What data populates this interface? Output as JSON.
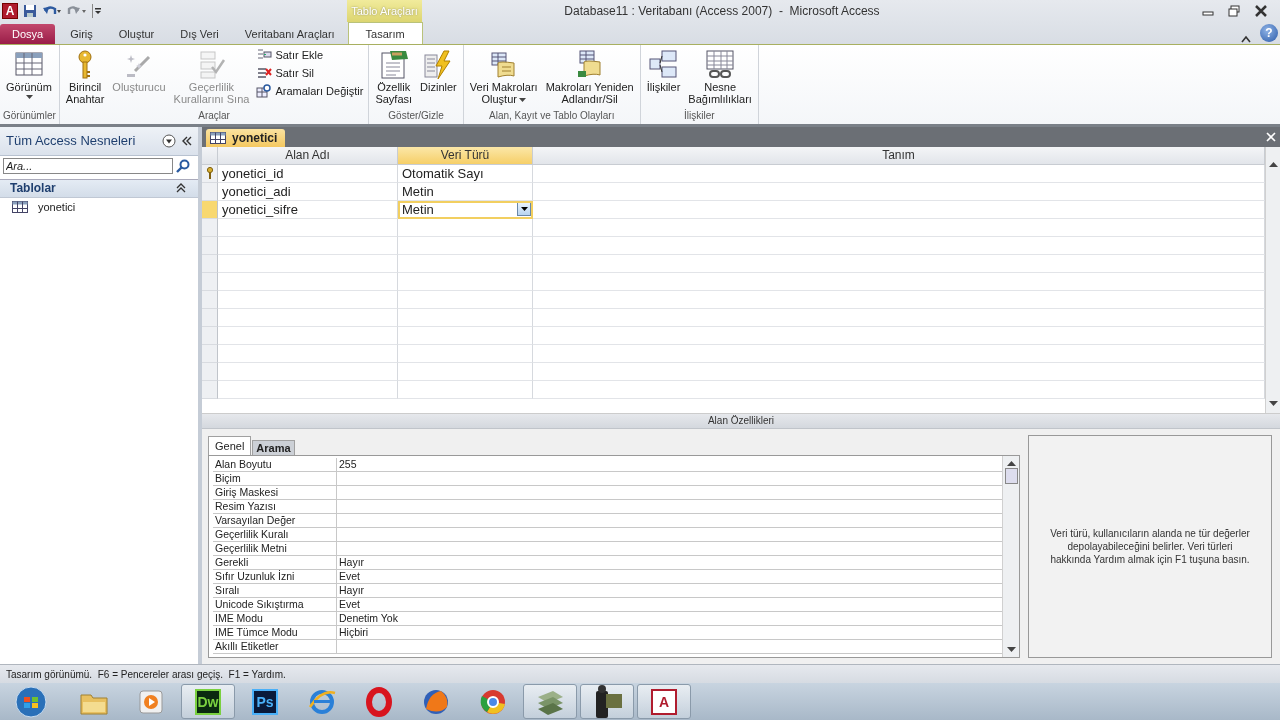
{
  "window": {
    "app_glyph": "A",
    "context_group": "Tablo Araçları",
    "title": "Database11 : Veritabanı (Access 2007)  -  Microsoft Access",
    "help_glyph": "?"
  },
  "ribbon_tabs": [
    {
      "label": "Dosya",
      "kind": "file",
      "selected": false
    },
    {
      "label": "Giriş",
      "kind": "tab",
      "selected": false
    },
    {
      "label": "Oluştur",
      "kind": "tab",
      "selected": false
    },
    {
      "label": "Dış Veri",
      "kind": "tab",
      "selected": false
    },
    {
      "label": "Veritabanı Araçları",
      "kind": "tab",
      "selected": false
    },
    {
      "label": "Tasarım",
      "kind": "context",
      "selected": true
    }
  ],
  "ribbon_groups": [
    {
      "label": "Görünümler",
      "buttons": [
        {
          "label": "Görünüm",
          "kind": "large",
          "disabled": false,
          "dropdown": true
        }
      ]
    },
    {
      "label": "Araçlar",
      "buttons": [
        {
          "label": "Birincil\nAnahtar",
          "kind": "large",
          "disabled": false,
          "dropdown": false
        },
        {
          "label": "Oluşturucu",
          "kind": "large",
          "disabled": true,
          "dropdown": false
        },
        {
          "label": "Geçerlilik\nKurallarını Sına",
          "kind": "large",
          "disabled": true,
          "dropdown": false
        },
        {
          "label": "Satır Ekle",
          "kind": "small",
          "disabled": false,
          "dropdown": false
        },
        {
          "label": "Satır Sil",
          "kind": "small",
          "disabled": false,
          "dropdown": false
        },
        {
          "label": "Aramaları Değiştir",
          "kind": "small",
          "disabled": false,
          "dropdown": false
        }
      ]
    },
    {
      "label": "Göster/Gizle",
      "buttons": [
        {
          "label": "Özellik\nSayfası",
          "kind": "large",
          "disabled": false,
          "dropdown": false
        },
        {
          "label": "Dizinler",
          "kind": "large",
          "disabled": false,
          "dropdown": false
        }
      ]
    },
    {
      "label": "Alan, Kayıt ve Tablo Olayları",
      "buttons": [
        {
          "label": "Veri Makroları\nOluştur",
          "kind": "large",
          "disabled": false,
          "dropdown": true
        },
        {
          "label": "Makroları Yeniden\nAdlandır/Sil",
          "kind": "large",
          "disabled": false,
          "dropdown": false
        }
      ]
    },
    {
      "label": "İlişkiler",
      "buttons": [
        {
          "label": "İlişkiler",
          "kind": "large",
          "disabled": false,
          "dropdown": false
        },
        {
          "label": "Nesne\nBağımlılıkları",
          "kind": "large",
          "disabled": false,
          "dropdown": false
        }
      ]
    }
  ],
  "navigation_pane": {
    "title": "Tüm Access Nesneleri",
    "search": {
      "placeholder": "Ara..."
    },
    "groups": [
      {
        "label": "Tablolar",
        "expanded": true,
        "items": [
          {
            "label": "yonetici"
          }
        ]
      }
    ]
  },
  "document_tabs": [
    {
      "label": "yonetici",
      "selected": true
    }
  ],
  "design_grid": {
    "columns": [
      {
        "label": "Alan Adı",
        "selected": false
      },
      {
        "label": "Veri Türü",
        "selected": true
      },
      {
        "label": "Tanım",
        "selected": false
      }
    ],
    "rows": [
      {
        "field_name": "yonetici_id",
        "data_type": "Otomatik Sayı",
        "primary_key": true,
        "selected": false
      },
      {
        "field_name": "yonetici_adi",
        "data_type": "Metin",
        "primary_key": false,
        "selected": false
      },
      {
        "field_name": "yonetici_sifre",
        "data_type": "Metin",
        "primary_key": false,
        "selected": true
      }
    ]
  },
  "field_properties": {
    "title": "Alan Özellikleri",
    "tabs": [
      {
        "label": "Genel",
        "selected": true
      },
      {
        "label": "Arama",
        "selected": false
      }
    ],
    "rows": [
      {
        "name": "Alan Boyutu",
        "value": "255"
      },
      {
        "name": "Biçim"
      },
      {
        "name": "Giriş Maskesi"
      },
      {
        "name": "Resim Yazısı"
      },
      {
        "name": "Varsayılan Değer"
      },
      {
        "name": "Geçerlilik Kuralı"
      },
      {
        "name": "Geçerlilik Metni"
      },
      {
        "name": "Gerekli",
        "value": "Hayır"
      },
      {
        "name": "Sıfır Uzunluk İzni",
        "value": "Evet"
      },
      {
        "name": "Sıralı",
        "value": "Hayır"
      },
      {
        "name": "Unicode Sıkıştırma",
        "value": "Evet"
      },
      {
        "name": "IME Modu",
        "value": "Denetim Yok"
      },
      {
        "name": "IME Tümce Modu",
        "value": "Hiçbiri"
      },
      {
        "name": "Akıllı Etiketler"
      }
    ],
    "help_text": "Veri türü, kullanıcıların alanda ne tür değerler depolayabileceğini belirler. Veri türleri hakkında Yardım almak için F1 tuşuna basın."
  },
  "status_bar": {
    "text": "Tasarım görünümü.  F6 = Pencereler arası geçiş.  F1 = Yardım."
  },
  "taskbar": {
    "items": [
      {
        "running": false
      },
      {
        "running": false
      },
      {
        "glyph": "Dw",
        "running": true
      },
      {
        "glyph": "Ps",
        "running": false
      },
      {
        "running": false
      },
      {
        "running": false
      },
      {
        "running": false
      },
      {
        "running": false
      },
      {
        "running": true
      },
      {
        "running": true
      },
      {
        "glyph": "A",
        "running": true
      }
    ]
  }
}
